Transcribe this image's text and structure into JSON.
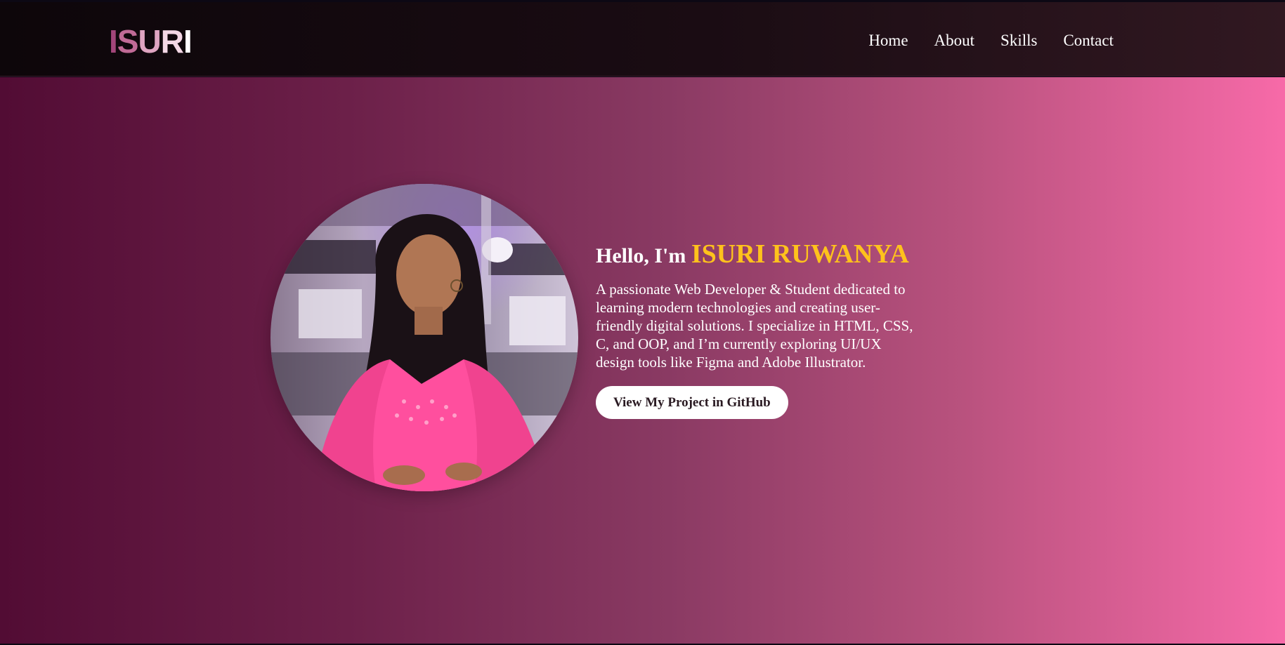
{
  "header": {
    "logo": "ISURI",
    "nav": [
      "Home",
      "About",
      "Skills",
      "Contact"
    ]
  },
  "hero": {
    "greeting_prefix": "Hello, I'm ",
    "name": "ISURI RUWANYA",
    "description": "A passionate Web Developer & Student dedicated to learning modern technologies and creating user-friendly digital solutions. I specialize in HTML, CSS, C, and OOP, and I’m currently exploring UI/UX design tools like Figma and Adobe Illustrator.",
    "button_label": "View My Project in GitHub"
  },
  "colors": {
    "accent_name": "#ffc21c",
    "logo_gradient": [
      "#a3457a",
      "#c9739c",
      "#e8b3cd",
      "#ffffff"
    ],
    "hero_gradient_start": "#520c34",
    "hero_gradient_end": "#f76aa8"
  }
}
